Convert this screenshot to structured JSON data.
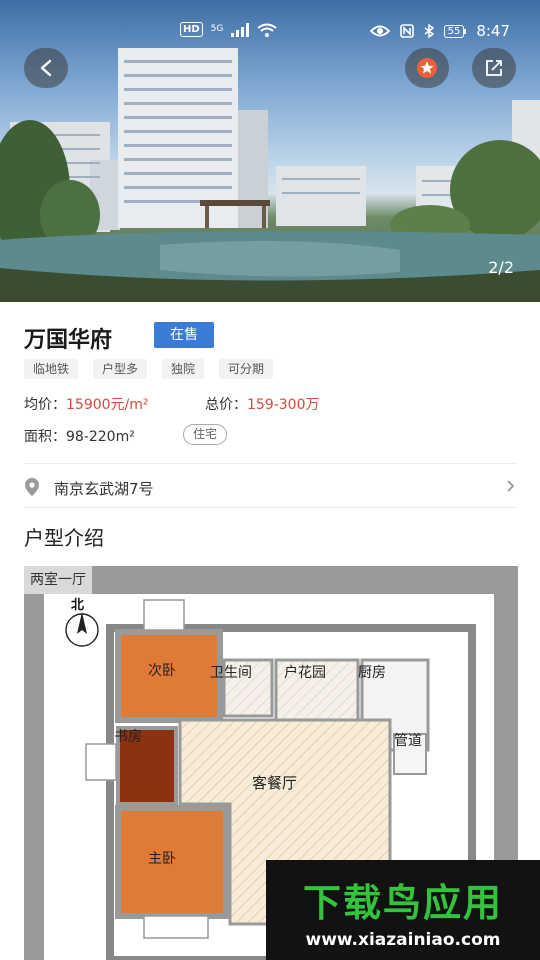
{
  "status_bar": {
    "network_badge": "HD",
    "network_type": "5G",
    "battery": "55",
    "time": "8:47"
  },
  "hero": {
    "image_counter": "2/2"
  },
  "property": {
    "name": "万国华府",
    "status": "在售",
    "tags": [
      "临地铁",
      "户型多",
      "独院",
      "可分期"
    ],
    "avg_price_label": "均价：",
    "avg_price_value": "15900元/m²",
    "total_price_label": "总价：",
    "total_price_value": "159-300万",
    "area_label": "面积：",
    "area_value": "98-220m²",
    "type": "住宅",
    "address": "南京玄武湖7号"
  },
  "floor_plan": {
    "section_title": "户型介绍",
    "label": "两室一厅",
    "north": "北",
    "rooms": {
      "second_bedroom": "次卧",
      "bathroom": "卫生间",
      "garden": "户花园",
      "kitchen": "厨房",
      "study": "书房",
      "pipe": "管道",
      "living_dining": "客餐厅",
      "master_bedroom": "主卧"
    }
  },
  "watermark": {
    "brand": "下载鸟应用",
    "url": "www.xiazainiao.com"
  },
  "colors": {
    "accent": "#3a7bd5",
    "price": "#d34a3c",
    "watermark_green": "#35c23c"
  }
}
